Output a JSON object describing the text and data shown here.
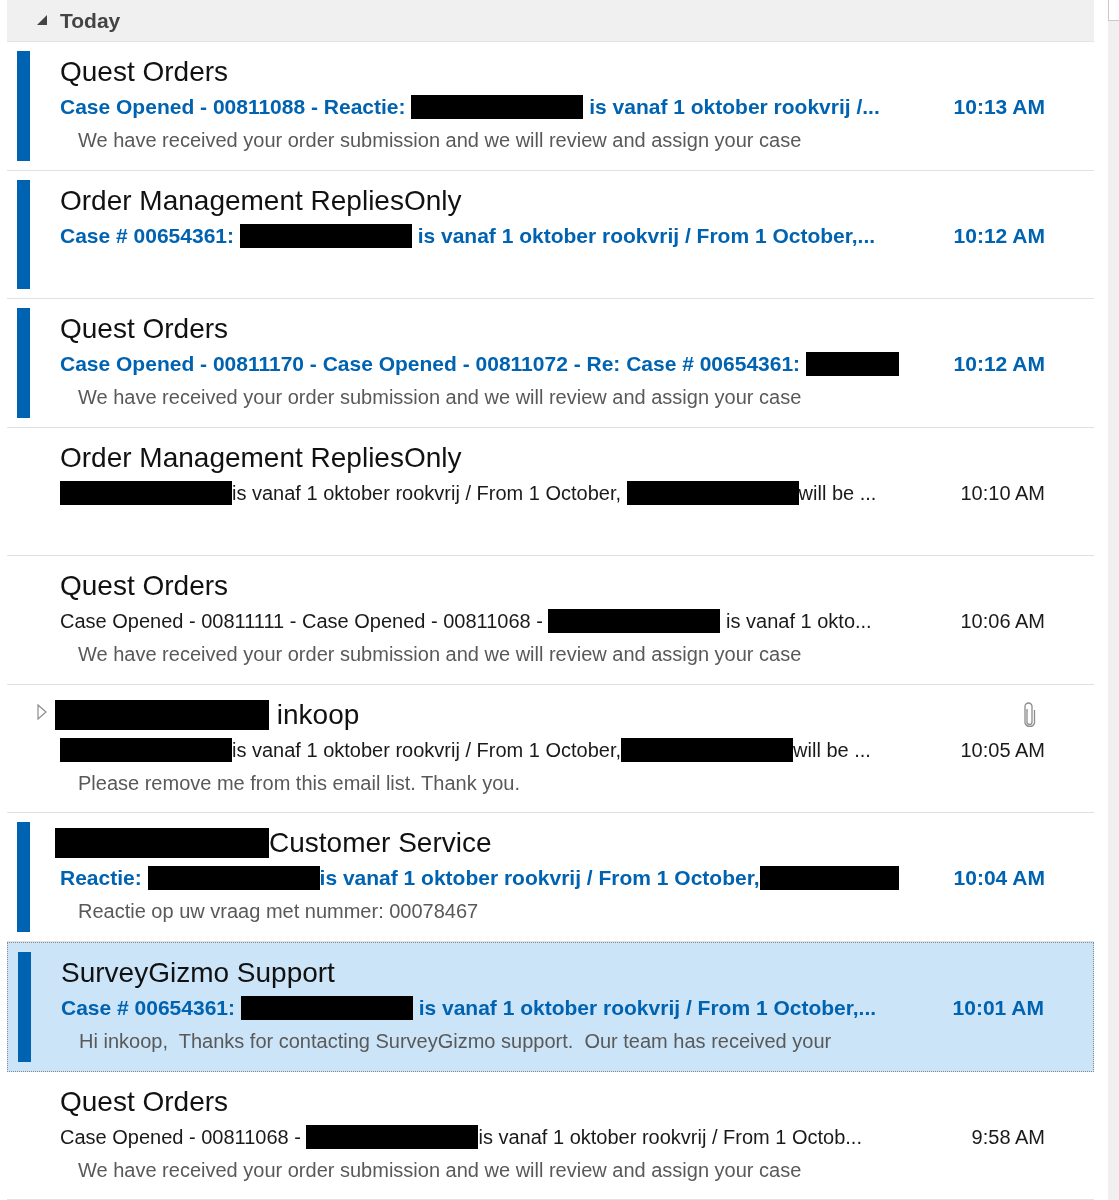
{
  "group": {
    "label": "Today",
    "expanded": true
  },
  "messages": [
    {
      "sender": [
        {
          "kind": "text",
          "text": "Quest Orders"
        }
      ],
      "subject": [
        {
          "kind": "text",
          "text": "Case Opened - 00811088 - Reactie: "
        },
        {
          "kind": "redaction"
        },
        {
          "kind": "text",
          "text": " is vanaf 1 oktober rookvrij /..."
        }
      ],
      "preview": "We have received your order submission and we will review and assign your case",
      "time": "10:13 AM",
      "unread": true,
      "selected": false,
      "thread": false,
      "attachment": false
    },
    {
      "sender": [
        {
          "kind": "text",
          "text": "Order Management RepliesOnly"
        }
      ],
      "subject": [
        {
          "kind": "text",
          "text": "Case # 00654361: "
        },
        {
          "kind": "redaction"
        },
        {
          "kind": "text",
          "text": " is vanaf 1 oktober rookvrij / From 1 October,..."
        }
      ],
      "time": "10:12 AM",
      "unread": true,
      "selected": false,
      "thread": false,
      "attachment": false
    },
    {
      "sender": [
        {
          "kind": "text",
          "text": "Quest Orders"
        }
      ],
      "subject": [
        {
          "kind": "text",
          "text": "Case Opened - 00811170 - Case Opened - 00811072 - Re: Case # 00654361: "
        },
        {
          "kind": "trailing_redaction"
        }
      ],
      "preview": "We have received your order submission and we will review and assign your case",
      "time": "10:12 AM",
      "unread": true,
      "selected": false,
      "thread": false,
      "attachment": false
    },
    {
      "sender": [
        {
          "kind": "text",
          "text": "Order Management RepliesOnly"
        }
      ],
      "subject": [
        {
          "kind": "redaction"
        },
        {
          "kind": "text",
          "text": "is vanaf 1 oktober rookvrij / From 1 October, "
        },
        {
          "kind": "redaction"
        },
        {
          "kind": "text",
          "text": "will be ..."
        }
      ],
      "time": "10:10 AM",
      "unread": false,
      "selected": false,
      "thread": false,
      "attachment": false
    },
    {
      "sender": [
        {
          "kind": "text",
          "text": "Quest Orders"
        }
      ],
      "subject": [
        {
          "kind": "text",
          "text": "Case Opened - 00811111 - Case Opened - 00811068 - "
        },
        {
          "kind": "redaction"
        },
        {
          "kind": "text",
          "text": " is vanaf 1 okto..."
        }
      ],
      "preview": "We have received your order submission and we will review and assign your case",
      "time": "10:06 AM",
      "unread": false,
      "selected": false,
      "thread": false,
      "attachment": false
    },
    {
      "sender": [
        {
          "kind": "redaction"
        },
        {
          "kind": "text",
          "text": " inkoop"
        }
      ],
      "subject": [
        {
          "kind": "redaction"
        },
        {
          "kind": "text",
          "text": "is vanaf 1 oktober rookvrij / From 1 October,"
        },
        {
          "kind": "redaction"
        },
        {
          "kind": "text",
          "text": "will be ..."
        }
      ],
      "preview": "Please remove me from this email list. Thank you.",
      "time": "10:05 AM",
      "unread": false,
      "selected": false,
      "thread": true,
      "attachment": true
    },
    {
      "sender": [
        {
          "kind": "redaction"
        },
        {
          "kind": "text",
          "text": "Customer Service"
        }
      ],
      "subject": [
        {
          "kind": "text",
          "text": "Reactie: "
        },
        {
          "kind": "redaction"
        },
        {
          "kind": "text",
          "text": "is vanaf 1 oktober rookvrij / From 1 October,"
        },
        {
          "kind": "trailing_redaction"
        }
      ],
      "preview": "Reactie op uw vraag met nummer: 00078467",
      "time": "10:04 AM",
      "unread": true,
      "selected": false,
      "thread": false,
      "attachment": false
    },
    {
      "sender": [
        {
          "kind": "text",
          "text": "SurveyGizmo Support"
        }
      ],
      "subject": [
        {
          "kind": "text",
          "text": "Case # 00654361: "
        },
        {
          "kind": "redaction"
        },
        {
          "kind": "text",
          "text": " is vanaf 1 oktober rookvrij / From 1 October,..."
        }
      ],
      "preview": "Hi inkoop,  Thanks for contacting SurveyGizmo support.  Our team has received your",
      "time": "10:01 AM",
      "unread": true,
      "selected": true,
      "thread": false,
      "attachment": false
    },
    {
      "sender": [
        {
          "kind": "text",
          "text": "Quest Orders"
        }
      ],
      "subject": [
        {
          "kind": "text",
          "text": "Case Opened - 00811068 - "
        },
        {
          "kind": "redaction"
        },
        {
          "kind": "text",
          "text": "is vanaf 1 oktober rookvrij / From 1 Octob..."
        }
      ],
      "preview": "We have received your order submission and we will review and assign your case",
      "time": "9:58 AM",
      "unread": false,
      "selected": false,
      "thread": false,
      "attachment": false
    }
  ]
}
